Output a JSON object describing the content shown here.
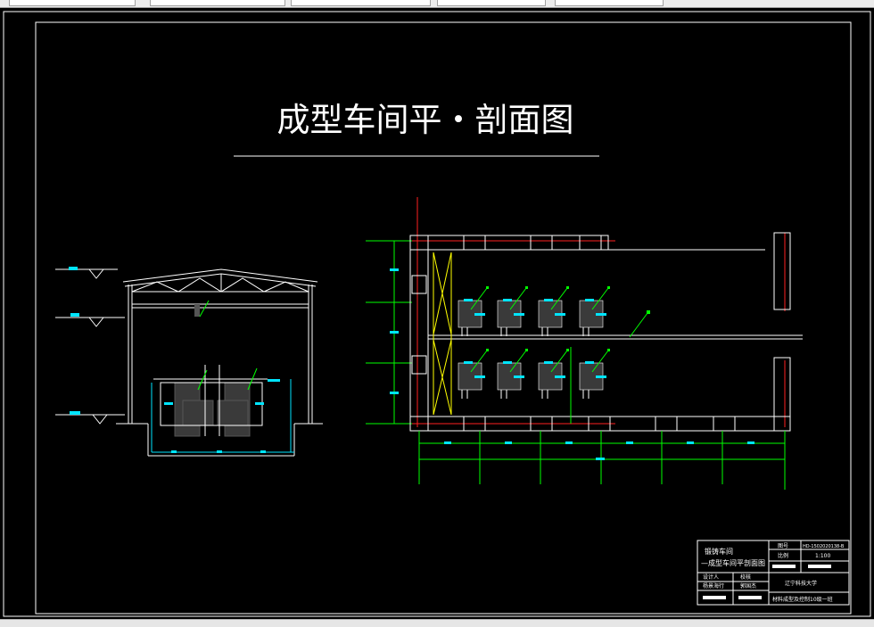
{
  "drawing": {
    "title": "成型车间平・剖面图"
  },
  "title_block": {
    "name_line1": "锻铸车间",
    "name_line2": "—成型车间平剖面图",
    "label_drawing_no": "图号",
    "drawing_no": "HD-1502020138-B",
    "label_scale": "比例",
    "scale": "1:100",
    "label_designer": "设计人",
    "label_reviewer": "校核",
    "designer_name": "杨景海行",
    "reviewer_name": "郭国杰",
    "school": "辽宁科技大学",
    "class_name": "材料成型及控制10级一班"
  },
  "colors": {
    "background": "#000000",
    "line": "#ffffff",
    "dimension": "#00ff00",
    "label_box": "#00e5ff",
    "column_axis": "#ff2020",
    "equipment": "#3a3a3a",
    "rail": "#ffff00"
  }
}
